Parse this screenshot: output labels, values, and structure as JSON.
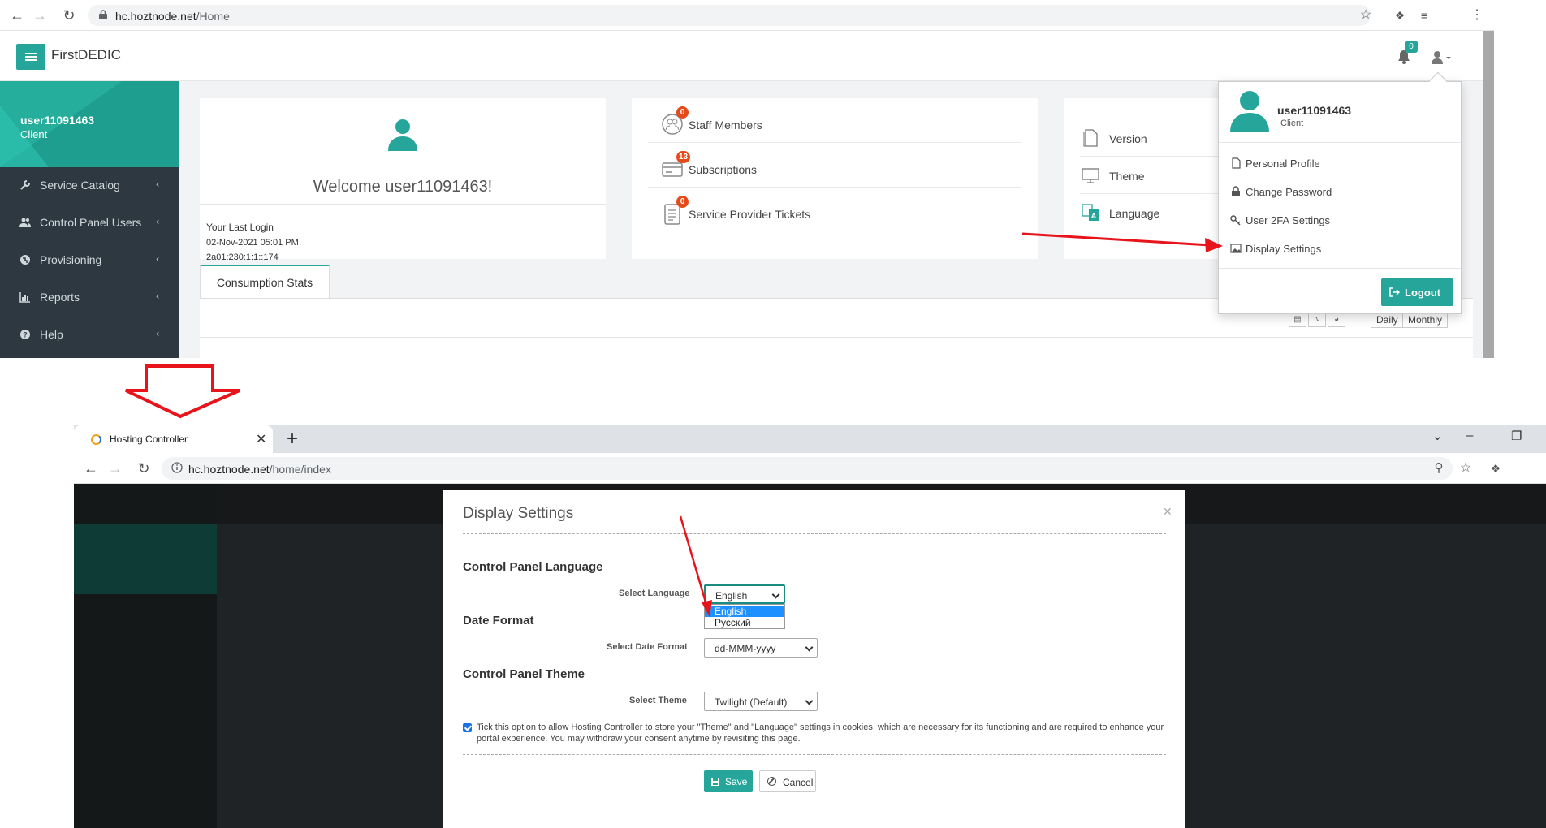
{
  "top": {
    "browser": {
      "url_host": "hc.hoztnode.net",
      "url_path": "/Home"
    },
    "header": {
      "brand": "FirstDEDIC",
      "notifications": "0"
    },
    "sidebar": {
      "user_name": "user11091463",
      "user_role": "Client",
      "items": [
        {
          "label": "Service Catalog",
          "icon": "wrench-icon"
        },
        {
          "label": "Control Panel Users",
          "icon": "users-icon"
        },
        {
          "label": "Provisioning",
          "icon": "globe-icon"
        },
        {
          "label": "Reports",
          "icon": "bar-chart-icon"
        },
        {
          "label": "Help",
          "icon": "question-icon"
        }
      ]
    },
    "welcome": {
      "text": "Welcome user11091463!",
      "last_login_label": "Your Last Login",
      "last_login_date": "02-Nov-2021 05:01 PM",
      "last_login_ip": "2a01:230:1:1::174"
    },
    "stats": [
      {
        "label": "Staff Members",
        "count": "0"
      },
      {
        "label": "Subscriptions",
        "count": "13"
      },
      {
        "label": "Service Provider Tickets",
        "count": "0"
      }
    ],
    "info": [
      {
        "label": "Version"
      },
      {
        "label": "Theme"
      },
      {
        "label": "Language"
      }
    ],
    "tabs": {
      "consumption": "Consumption Stats"
    },
    "period": {
      "daily": "Daily",
      "monthly": "Monthly"
    },
    "user_menu": {
      "name": "user11091463",
      "role": "Client",
      "items": [
        {
          "label": "Personal Profile",
          "icon": "file-icon"
        },
        {
          "label": "Change Password",
          "icon": "lock-icon"
        },
        {
          "label": "User 2FA Settings",
          "icon": "key-icon"
        },
        {
          "label": "Display Settings",
          "icon": "image-icon"
        }
      ],
      "logout": "Logout"
    }
  },
  "bottom": {
    "browser": {
      "tab_title": "Hosting Controller",
      "url_host": "hc.hoztnode.net",
      "url_path": "/home/index"
    },
    "modal": {
      "title": "Display Settings",
      "language_section": "Control Panel Language",
      "language_label": "Select Language",
      "language_value": "English",
      "language_options": [
        "English",
        "Русский"
      ],
      "date_section": "Date Format",
      "date_label": "Select Date Format",
      "date_value": "dd-MMM-yyyy",
      "theme_section": "Control Panel Theme",
      "theme_label": "Select Theme",
      "theme_value": "Twilight (Default)",
      "consent_checked": true,
      "consent_text": "Tick this option to allow Hosting Controller to store your \"Theme\" and \"Language\" settings in cookies, which are necessary for its functioning and are required to enhance your portal experience. You may withdraw your consent anytime by revisiting this page.",
      "save": "Save",
      "cancel": "Cancel"
    }
  },
  "colors": {
    "accent": "#26a69a",
    "sidebar": "#2e3840",
    "badge": "#e64a19",
    "annotation": "#e8141c"
  }
}
